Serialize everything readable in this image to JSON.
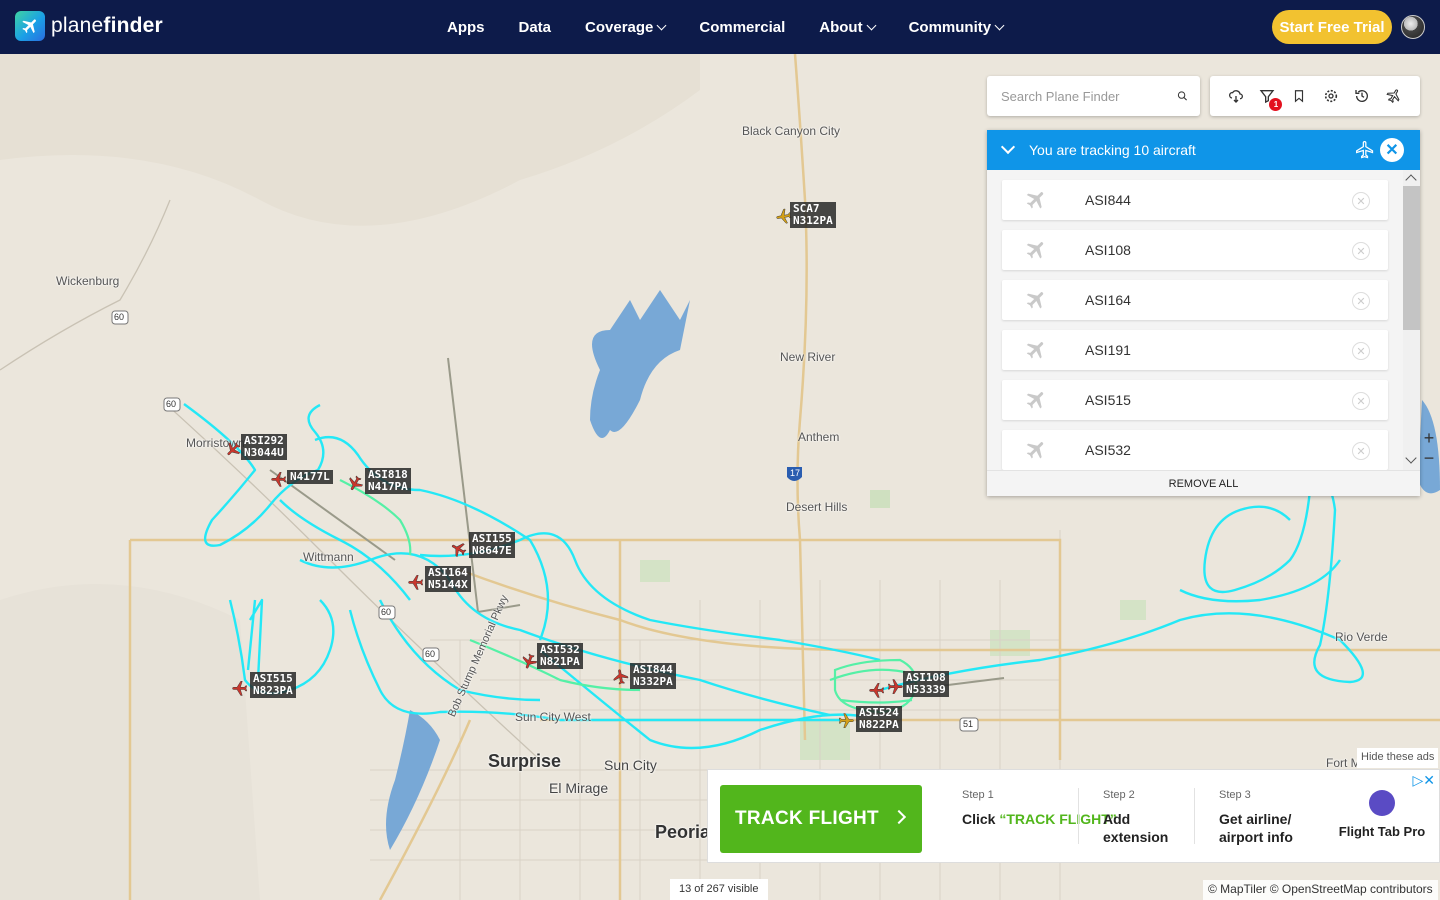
{
  "header": {
    "logo_text_pre": "plane",
    "logo_text_bold": "finder",
    "nav": [
      {
        "label": "Apps",
        "dropdown": false
      },
      {
        "label": "Data",
        "dropdown": false
      },
      {
        "label": "Coverage",
        "dropdown": true
      },
      {
        "label": "Commercial",
        "dropdown": false
      },
      {
        "label": "About",
        "dropdown": true
      },
      {
        "label": "Community",
        "dropdown": true
      }
    ],
    "cta": "Start Free Trial"
  },
  "search": {
    "placeholder": "Search Plane Finder"
  },
  "toolbar": {
    "icons": [
      "weather-icon",
      "filter-icon",
      "bookmark-icon",
      "settings-icon",
      "history-icon",
      "radar-icon"
    ],
    "filter_badge": "1"
  },
  "tracking": {
    "title": "You are tracking 10 aircraft",
    "items": [
      "ASI844",
      "ASI108",
      "ASI164",
      "ASI191",
      "ASI515",
      "ASI532"
    ],
    "remove_all": "REMOVE ALL"
  },
  "map": {
    "places": [
      {
        "name": "Black Canyon City",
        "cls": ""
      },
      {
        "name": "Wickenburg",
        "cls": ""
      },
      {
        "name": "New River",
        "cls": ""
      },
      {
        "name": "Anthem",
        "cls": ""
      },
      {
        "name": "Desert Hills",
        "cls": ""
      },
      {
        "name": "Morristown",
        "cls": ""
      },
      {
        "name": "Wittmann",
        "cls": ""
      },
      {
        "name": "Sun City West",
        "cls": ""
      },
      {
        "name": "Surprise",
        "cls": "big"
      },
      {
        "name": "Sun City",
        "cls": "mid"
      },
      {
        "name": "El Mirage",
        "cls": "mid"
      },
      {
        "name": "Peoria",
        "cls": "big"
      },
      {
        "name": "Rio Verde",
        "cls": ""
      },
      {
        "name": "Fort M",
        "cls": ""
      },
      {
        "name": "Bob Stump Memorial Pkwy",
        "cls": ""
      }
    ],
    "shields": [
      "60",
      "60",
      "60",
      "60",
      "17",
      "51"
    ],
    "aircraft": [
      {
        "line1": "SCA7",
        "line2": "N312PA",
        "color": "#d4a017"
      },
      {
        "line1": "ASI292",
        "line2": "N3044U",
        "color": "#c8372d"
      },
      {
        "line1": "N4177L",
        "line2": "",
        "color": "#c8372d"
      },
      {
        "line1": "ASI818",
        "line2": "N417PA",
        "color": "#c8372d"
      },
      {
        "line1": "ASI155",
        "line2": "N8647E",
        "color": "#c8372d"
      },
      {
        "line1": "ASI164",
        "line2": "N5144X",
        "color": "#c8372d"
      },
      {
        "line1": "ASI532",
        "line2": "N821PA",
        "color": "#c8372d"
      },
      {
        "line1": "ASI844",
        "line2": "N332PA",
        "color": "#c8372d"
      },
      {
        "line1": "ASI515",
        "line2": "N823PA",
        "color": "#c8372d"
      },
      {
        "line1": "ASI108",
        "line2": "N53339",
        "color": "#c8372d"
      },
      {
        "line1": "ASI524",
        "line2": "N822PA",
        "color": "#d4a017"
      }
    ],
    "zoom_in": "+",
    "zoom_out": "−"
  },
  "ad": {
    "hide": "Hide these ads",
    "button": "TRACK FLIGHT",
    "steps": [
      {
        "n": "Step 1",
        "t1": "Click ",
        "t2": "“TRACK FLIGHT”"
      },
      {
        "n": "Step 2",
        "t1": "Add extension",
        "t2": ""
      },
      {
        "n": "Step 3",
        "t1": "Get airline/ airport info",
        "t2": ""
      }
    ],
    "brand": "Flight Tab Pro"
  },
  "status": {
    "visible": "13 of 267 visible",
    "attribution": "© MapTiler © OpenStreetMap contributors"
  }
}
